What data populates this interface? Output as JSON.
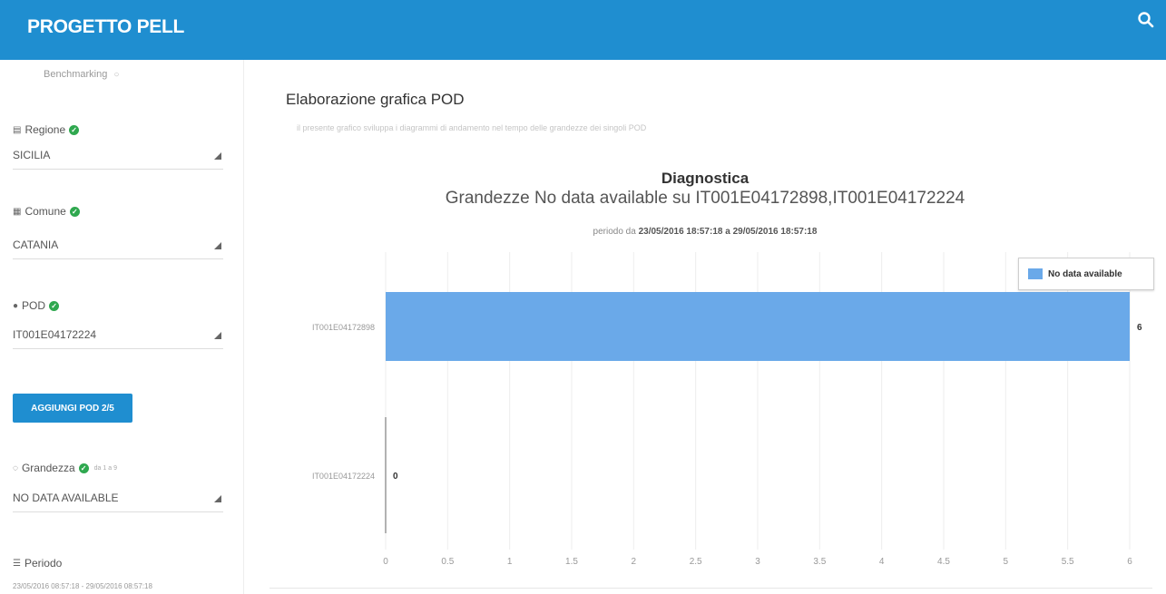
{
  "app": {
    "title": "PROGETTO PELL"
  },
  "sidebar": {
    "benchmarking": "Benchmarking",
    "regione": {
      "label": "Regione",
      "value": "SICILIA"
    },
    "comune": {
      "label": "Comune",
      "value": "CATANIA"
    },
    "pod": {
      "label": "POD",
      "value": "IT001E04172224"
    },
    "add_button": "AGGIUNGI POD 2/5",
    "grandezza": {
      "label": "Grandezza",
      "note": "da 1 a 9",
      "value": "NO DATA AVAILABLE"
    },
    "periodo": {
      "label": "Periodo",
      "value": "23/05/2016 08:57:18 - 29/05/2016 08:57:18"
    }
  },
  "main": {
    "title": "Elaborazione grafica POD",
    "subtitle": "il presente grafico sviluppa i diagrammi di andamento nel tempo delle grandezze dei singoli POD"
  },
  "chart_data": {
    "type": "bar",
    "orientation": "horizontal",
    "title": "Diagnostica",
    "subtitle": "Grandezze  No data available su IT001E04172898,IT001E04172224",
    "period_prefix": "periodo da",
    "period_range": "23/05/2016 18:57:18 a 29/05/2016 18:57:18",
    "categories": [
      "IT001E04172898",
      "IT001E04172224"
    ],
    "series": [
      {
        "name": "No data available",
        "values": [
          6,
          0
        ]
      }
    ],
    "data_labels": [
      "6",
      "0"
    ],
    "xlim": [
      0,
      6
    ],
    "xticks": [
      "0",
      "0.5",
      "1",
      "1.5",
      "2",
      "2.5",
      "3",
      "3.5",
      "4",
      "4.5",
      "5",
      "5.5",
      "6"
    ],
    "grid": true,
    "legend_position": "top-right",
    "bar_color": "#6aa9e9"
  }
}
